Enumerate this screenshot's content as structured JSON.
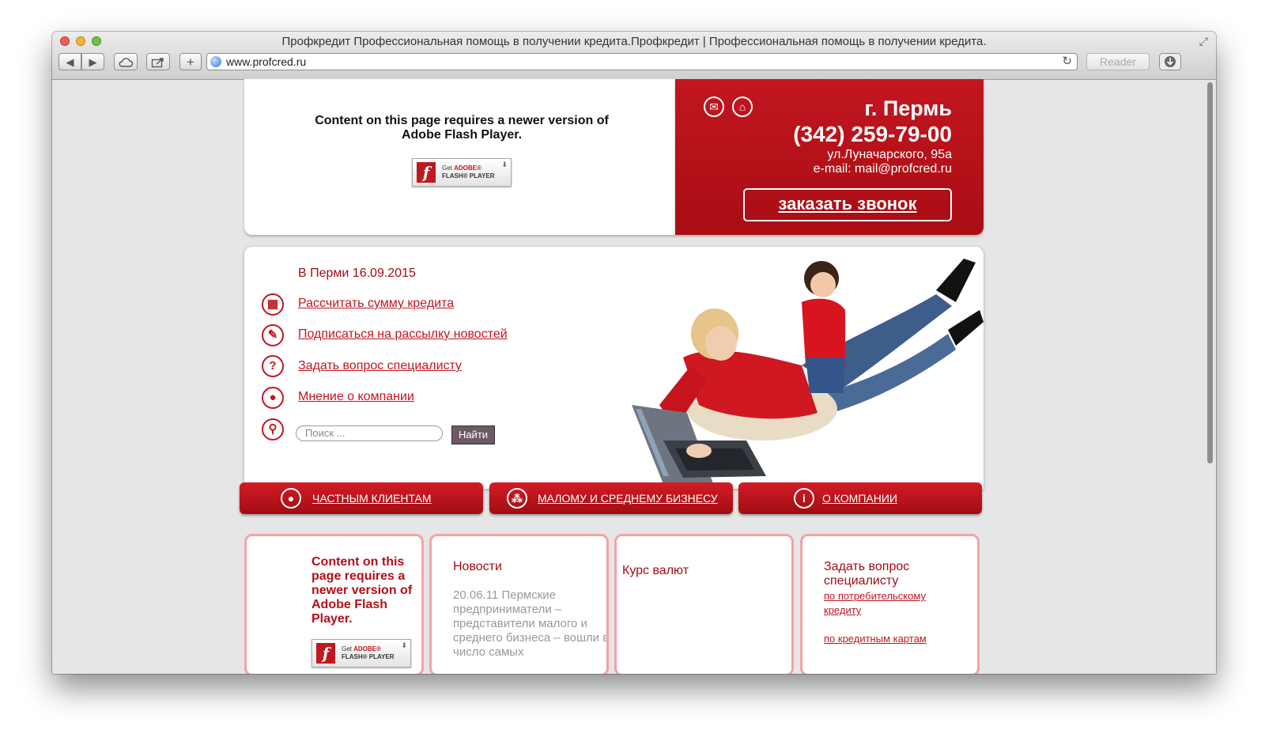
{
  "browser": {
    "title": "Профкредит Профессиональная помощь в получении кредита.Профкредит | Профессиональная помощь в получении кредита.",
    "url": "www.profcred.ru",
    "reader_label": "Reader",
    "icons": [
      "back-icon",
      "forward-icon",
      "icloud-icon",
      "share-icon",
      "add-tab-icon",
      "globe-icon",
      "reload-icon",
      "download-icon",
      "fullscreen-icon"
    ]
  },
  "header": {
    "flash_message": "Content on this page requires a newer version of Adobe Flash Player.",
    "flash_badge": {
      "line1_prefix": "Get ",
      "line1_brand": "ADOBE®",
      "line2": "FLASH® PLAYER",
      "glyph": "f"
    },
    "city": "г. Пермь",
    "phone": "(342) 259-79-00",
    "address": "ул.Луначарского, 95а",
    "email": "e-mail: mail@profcred.ru",
    "call_button": "заказать звонок"
  },
  "banner": {
    "date_line": "В Перми 16.09.2015",
    "links": [
      {
        "label": "Рассчитать сумму кредита",
        "icon": "calculator-icon"
      },
      {
        "label": "Подписаться на рассылку новостей",
        "icon": "subscribe-icon"
      },
      {
        "label": "Задать вопрос специалисту",
        "icon": "question-icon"
      },
      {
        "label": "Мнение о компании",
        "icon": "opinion-icon"
      }
    ],
    "search": {
      "placeholder": "Поиск ...",
      "button": "Найти",
      "icon": "search-icon"
    }
  },
  "nav": [
    {
      "label": "ЧАСТНЫМ КЛИЕНТАМ",
      "icon": "person-icon"
    },
    {
      "label": "МАЛОМУ  И СРЕДНЕМУ БИЗНЕСУ",
      "icon": "business-icon"
    },
    {
      "label": "О КОМПАНИИ",
      "icon": "info-icon"
    }
  ],
  "boxes": {
    "flash": {
      "message": "Content on this page requires a newer version of Adobe Flash Player."
    },
    "news": {
      "title": "Новости",
      "text": "20.06.11 Пермские предприниматели – представители малого и среднего бизнеса – вошли в число самых"
    },
    "currency": {
      "title": "Курс валют"
    },
    "question": {
      "title": "Задать вопрос специалисту",
      "links": [
        "по потребительскому кредиту",
        "по кредитным картам"
      ]
    }
  },
  "colors": {
    "brand_red": "#c2161f",
    "link_red": "#c41520",
    "box_border": "#f2a3a6",
    "page_bg": "#e6e6e6"
  }
}
